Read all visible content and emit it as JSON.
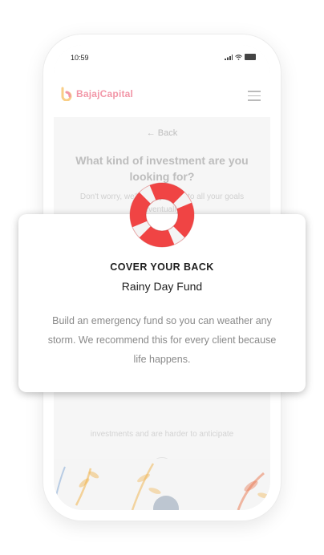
{
  "status_bar": {
    "time": "10:59",
    "icons": [
      "signal-icon",
      "wifi-icon",
      "battery-icon"
    ]
  },
  "header": {
    "brand": "BajajCapital",
    "menu_icon": "hamburger-menu-icon"
  },
  "page": {
    "back_label": "← Back",
    "question": "What kind of investment are you looking for?",
    "hint": "Don't worry, we'll help you get to all your goals eventually",
    "faded_line": "investments and are harder to anticipate"
  },
  "modal": {
    "icon": "lifebuoy-icon",
    "kicker": "COVER YOUR BACK",
    "title": "Rainy Day Fund",
    "body": "Build an emergency fund so you can weather any storm. We recommend this for every client because life happens."
  },
  "colors": {
    "brand": "#e83e5d",
    "lifebuoy_red": "#f04444",
    "lifebuoy_white": "#f4f4f4"
  }
}
